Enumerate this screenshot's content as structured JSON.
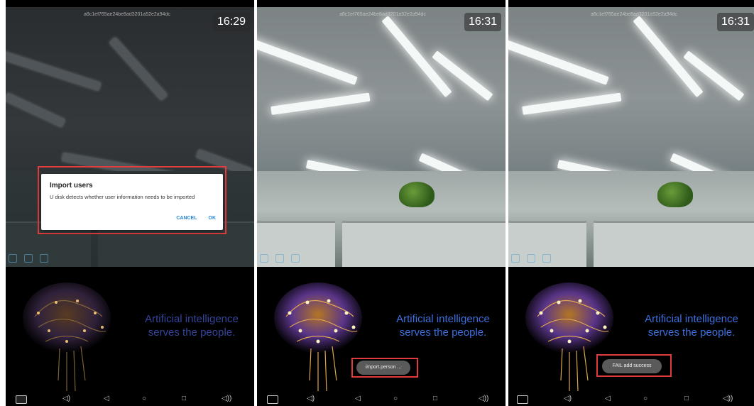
{
  "panels": [
    {
      "device_id": "a6c1ef765ae24be8ad3201a52e2a94dc",
      "time": "16:29",
      "dialog": {
        "title": "Import users",
        "message": "U disk detects whether user information needs to be imported",
        "cancel_label": "CANCEL",
        "ok_label": "OK"
      },
      "ai_text_line1": "Artificial intelligence",
      "ai_text_line2": "serves the people."
    },
    {
      "device_id": "a6c1ef765ae24be8ad3201a52e2a94dc",
      "time": "16:31",
      "toast": "import person ...",
      "ai_text_line1": "Artificial intelligence",
      "ai_text_line2": "serves the people."
    },
    {
      "device_id": "a6c1ef765ae24be8ad3201a52e2a94dc",
      "time": "16:31",
      "toast": "FAIL add success",
      "ai_text_line1": "Artificial intelligence",
      "ai_text_line2": "serves the people."
    }
  ],
  "navbar": {
    "icons": [
      "screenshot-icon",
      "volume-down-icon",
      "back-icon",
      "home-icon",
      "recents-icon",
      "volume-up-icon"
    ],
    "glyphs": {
      "volume_down": "◁)",
      "back": "◁",
      "home": "○",
      "recents": "□",
      "volume_up": "◁))"
    }
  },
  "colors": {
    "highlight": "#e23b3b",
    "dialog_button": "#2a87d5",
    "ai_text": "#3e6fdf"
  }
}
